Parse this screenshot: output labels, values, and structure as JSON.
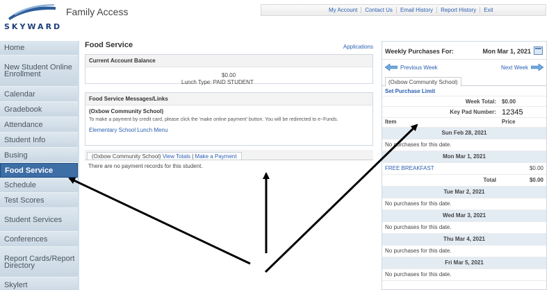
{
  "header": {
    "logo_text": "SKYWARD",
    "app_title": "Family Access",
    "links": [
      "My Account",
      "Contact Us",
      "Email History",
      "Report History",
      "Exit"
    ]
  },
  "sidebar": {
    "items": [
      {
        "label": "Home"
      },
      {
        "label": "New Student Online Enrollment"
      },
      {
        "label": "Calendar"
      },
      {
        "label": "Gradebook"
      },
      {
        "label": "Attendance"
      },
      {
        "label": "Student Info"
      },
      {
        "label": "Busing"
      },
      {
        "label": "Food Service",
        "active": true
      },
      {
        "label": "Schedule"
      },
      {
        "label": "Test Scores"
      },
      {
        "label": "Student Services"
      },
      {
        "label": "Conferences"
      },
      {
        "label": "Report Cards/Report Directory"
      },
      {
        "label": "Skylert"
      }
    ]
  },
  "main": {
    "title": "Food Service",
    "applications_link": "Applications",
    "balance": {
      "header": "Current Account Balance",
      "amount": "$0.00",
      "lunch_type": "Lunch Type:  PAID STUDENT"
    },
    "messages": {
      "header": "Food Service Messages/Links",
      "school": "(Oxbow Community School)",
      "body": "To make a payment by credit card, please click the 'make online payment' button. You will be redirected to e~Funds.",
      "link": "Elementary School Lunch Menu"
    },
    "payments": {
      "school": "(Oxbow Community School)",
      "view_totals": "View Totals",
      "separator": "|",
      "make_payment": "Make a Payment",
      "empty_message": "There are no payment records for this student."
    }
  },
  "weekly": {
    "label": "Weekly Purchases For:",
    "date": "Mon Mar 1, 2021",
    "prev": "Previous Week",
    "next": "Next Week",
    "tab": "(Oxbow Community School)",
    "set_limit": "Set Purchase Limit",
    "week_total_label": "Week Total:",
    "week_total": "$0.00",
    "keypad_label": "Key Pad Number:",
    "keypad_value": "12345",
    "col_item": "Item",
    "col_price": "Price",
    "days": [
      {
        "date": "Sun Feb 28, 2021",
        "no_purchases": "No purchases for this date."
      },
      {
        "date": "Mon Mar 1, 2021",
        "item": "FREE BREAKFAST",
        "item_price": "$0.00",
        "total_label": "Total",
        "total": "$0.00"
      },
      {
        "date": "Tue Mar 2, 2021",
        "no_purchases": "No purchases for this date."
      },
      {
        "date": "Wed Mar 3, 2021",
        "no_purchases": "No purchases for this date."
      },
      {
        "date": "Thu Mar 4, 2021",
        "no_purchases": "No purchases for this date."
      },
      {
        "date": "Fri Mar 5, 2021",
        "no_purchases": "No purchases for this date."
      }
    ]
  },
  "colors": {
    "accent": "#3e6ea6",
    "link": "#2a5fb0",
    "sidebar": "#cfdde8"
  }
}
